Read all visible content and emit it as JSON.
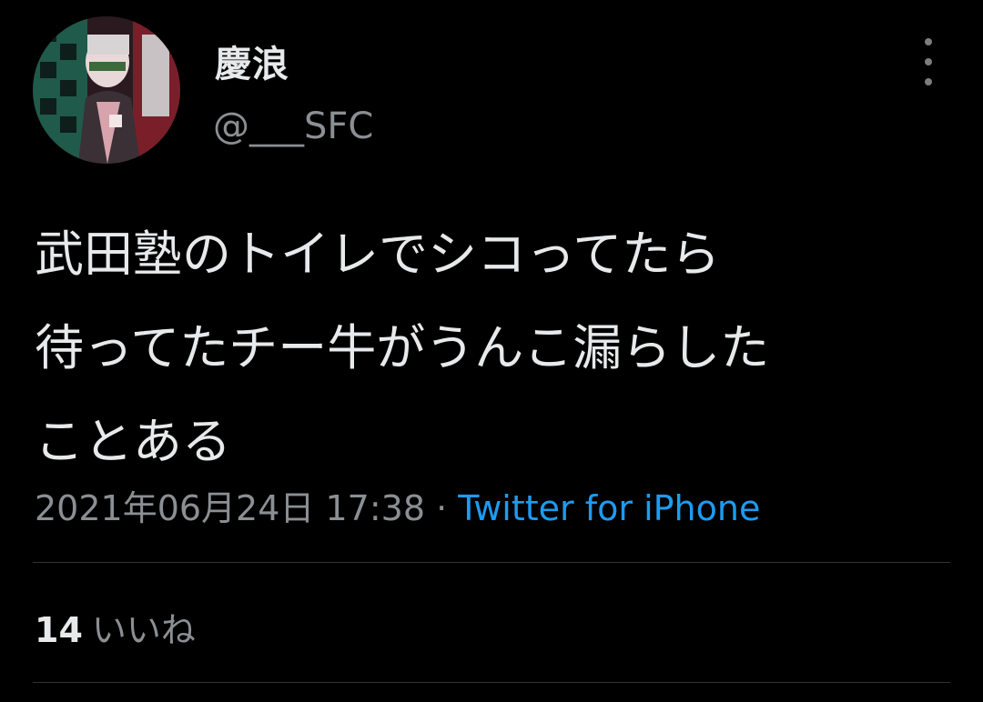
{
  "user": {
    "display_name": "慶浪",
    "handle": "@___SFC"
  },
  "tweet": {
    "text_lines": [
      "武田塾のトイレでシコってたら",
      "待ってたチー牛がうんこ漏らした",
      "ことある"
    ],
    "date": "2021年06月24日 17:38",
    "separator": "·",
    "source": "Twitter for iPhone"
  },
  "engagement": {
    "likes_count": "14",
    "likes_label": "いいね"
  },
  "icons": {
    "more": "more-vertical-icon"
  },
  "colors": {
    "background": "#000000",
    "primary_text": "#e7e9ea",
    "secondary_text": "#8b8f93",
    "link": "#1d9bf0",
    "divider": "#2f3336"
  }
}
